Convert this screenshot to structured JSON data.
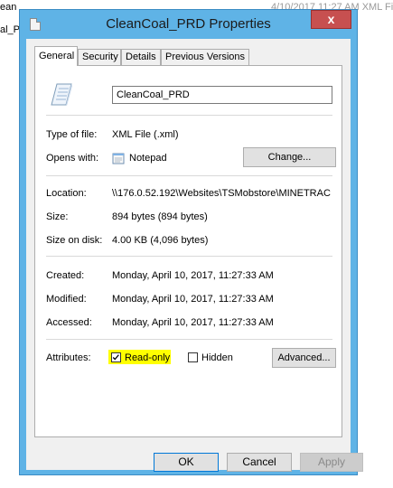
{
  "background": {
    "line1_left": "ean",
    "line1_right_frag": "4/10/2017 11:27 AM   XML File",
    "line2_left": "al_P"
  },
  "window": {
    "title": "CleanCoal_PRD Properties",
    "close_label": "x"
  },
  "tabs": [
    {
      "label": "General",
      "active": true
    },
    {
      "label": "Security",
      "active": false
    },
    {
      "label": "Details",
      "active": false
    },
    {
      "label": "Previous Versions",
      "active": false
    }
  ],
  "general": {
    "file_name": "CleanCoal_PRD",
    "type_label": "Type of file:",
    "type_value": "XML File (.xml)",
    "opens_label": "Opens with:",
    "opens_value": "Notepad",
    "change_button": "Change...",
    "location_label": "Location:",
    "location_value": "\\\\176.0.52.192\\Websites\\TSMobstore\\MINETRAC",
    "size_label": "Size:",
    "size_value": "894 bytes (894 bytes)",
    "size_on_disk_label": "Size on disk:",
    "size_on_disk_value": "4.00 KB (4,096 bytes)",
    "created_label": "Created:",
    "created_value": "Monday, April 10, 2017, 11:27:33 AM",
    "modified_label": "Modified:",
    "modified_value": "Monday, April 10, 2017, 11:27:33 AM",
    "accessed_label": "Accessed:",
    "accessed_value": "Monday, April 10, 2017, 11:27:33 AM",
    "attributes_label": "Attributes:",
    "readonly_label": "Read-only",
    "readonly_checked": true,
    "hidden_label": "Hidden",
    "hidden_checked": false,
    "advanced_button": "Advanced..."
  },
  "buttons": {
    "ok": "OK",
    "cancel": "Cancel",
    "apply": "Apply"
  },
  "colors": {
    "title_bar": "#5fb3e6",
    "close_button": "#c75050",
    "highlight": "#ffff00"
  }
}
